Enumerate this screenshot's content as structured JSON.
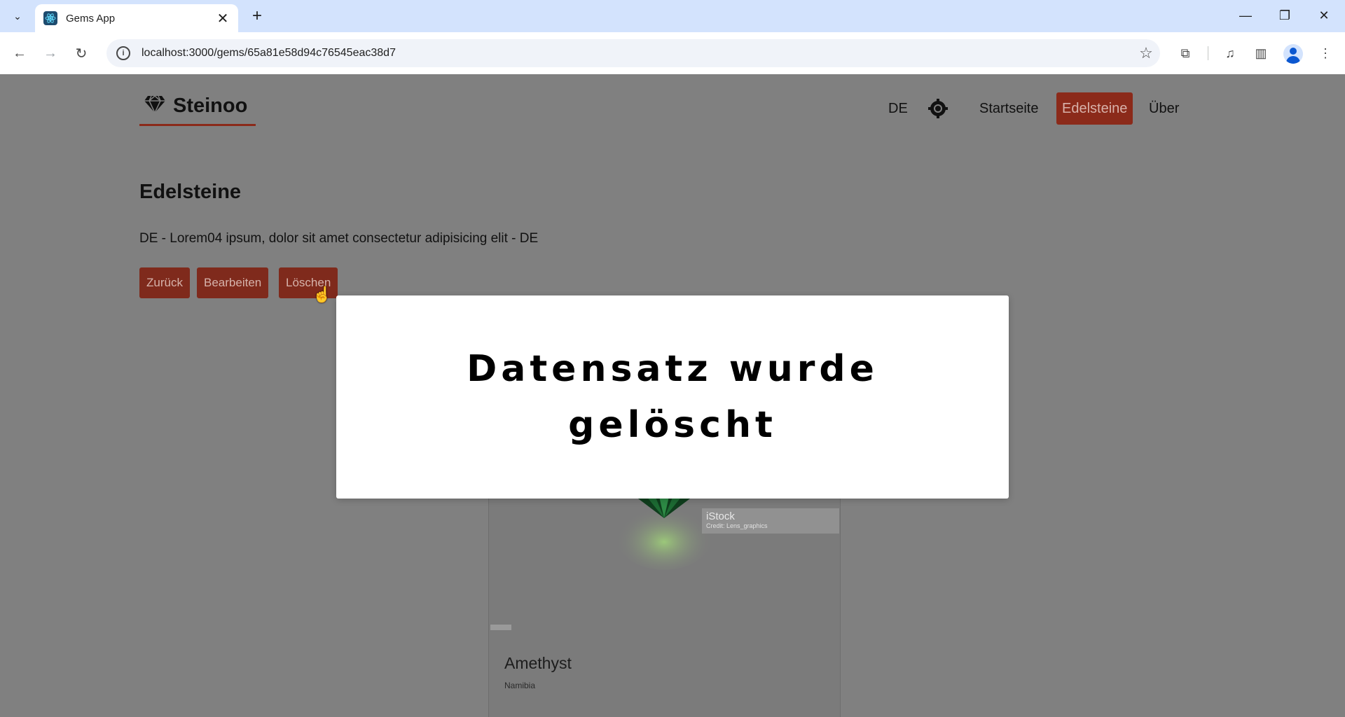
{
  "browser": {
    "tab_title": "Gems App",
    "url": "localhost:3000/gems/65a81e58d94c76545eac38d7"
  },
  "site": {
    "brand": "Steinoo",
    "nav": {
      "lang": "DE",
      "home": "Startseite",
      "gems": "Edelsteine",
      "about": "Über"
    }
  },
  "page": {
    "title": "Edelsteine",
    "description": "DE - Lorem04 ipsum, dolor sit amet consectetur adipisicing elit - DE",
    "buttons": {
      "back": "Zurück",
      "edit": "Bearbeiten",
      "delete": "Löschen"
    }
  },
  "card": {
    "watermark_brand": "iStock",
    "watermark_credit": "Credit: Lens_graphics",
    "title": "Amethyst",
    "subtitle": "Namibia"
  },
  "modal": {
    "message": "Datensatz wurde gelöscht"
  },
  "colors": {
    "accent": "#8b2a1a",
    "overlay": "#808080"
  }
}
